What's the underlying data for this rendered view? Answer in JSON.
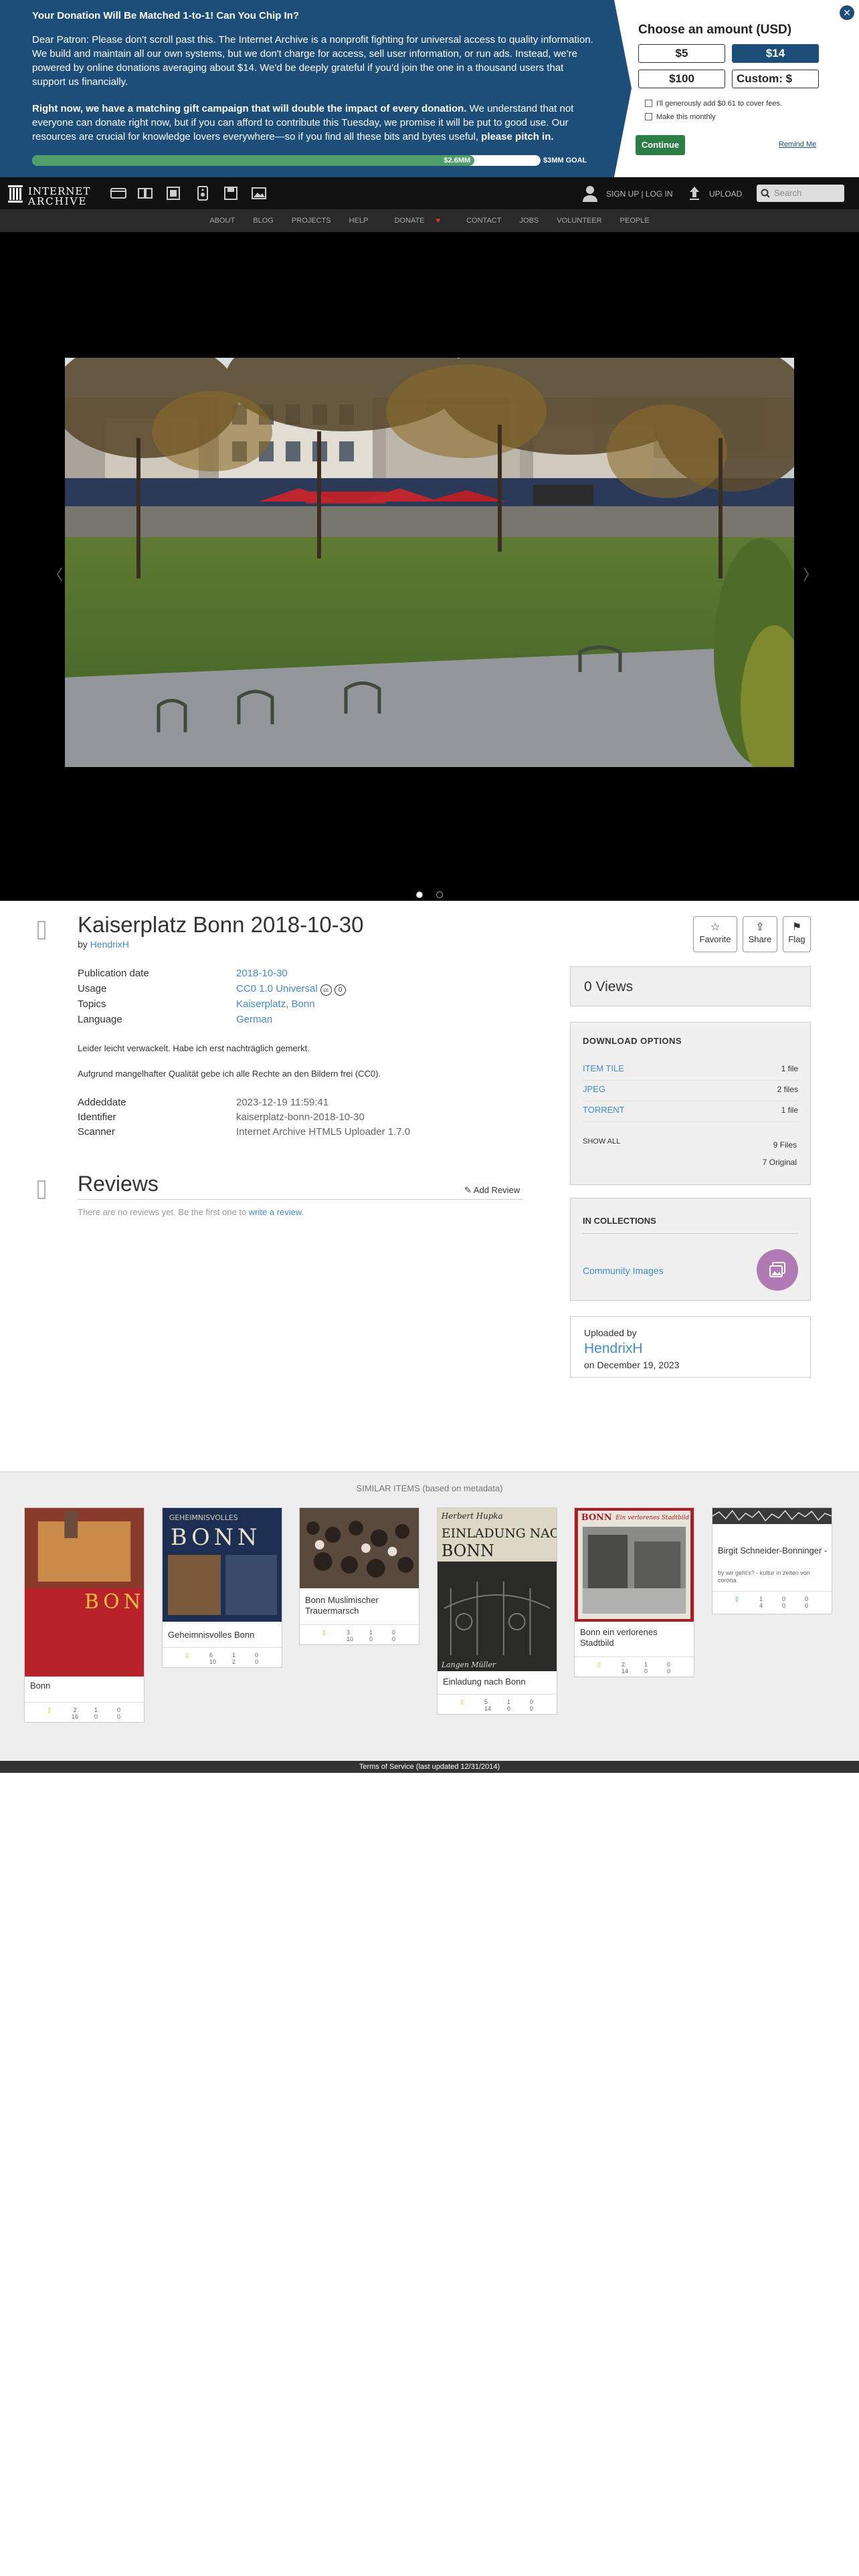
{
  "banner": {
    "headline": "Your Donation Will Be Matched 1-to-1! Can You Chip In?",
    "para1": "Dear Patron: Please don't scroll past this. The Internet Archive is a nonprofit fighting for universal access to quality information. We build and maintain all our own systems, but we don't charge for access, sell user information, or run ads. Instead, we're powered by online donations averaging about $14. We'd be deeply grateful if you'd join the one in a thousand users that support us financially.",
    "para2_bold": "Right now, we have a matching gift campaign that will double the impact of every donation.",
    "para2_rest": " We understand that not everyone can donate right now, but if you can afford to contribute this Tuesday, we promise it will be put to good use. Our resources are crucial for knowledge lovers everywhere—so if you find all these bits and bytes useful, ",
    "para2_end": "please pitch in.",
    "raised": "$2.6MM",
    "goal": "$3MM GOAL",
    "progress_fraction": 0.87,
    "choose_label": "Choose an amount (USD)",
    "amounts": [
      "$5",
      "$14",
      "$100",
      "Custom: $"
    ],
    "fee_label": "I'll generously add $0.61 to cover fees.",
    "monthly_label": "Make this monthly",
    "continue_label": "Continue",
    "remind_label": "Remind Me",
    "close_glyph": "✕",
    "colors": {
      "banner_bg": "#1d4e7a",
      "selected_amount": "#1d4e7a",
      "continue": "#2d7d46"
    }
  },
  "nav": {
    "logo_line1": "INTERNET",
    "logo_line2": "ARCHIVE",
    "media_icons": [
      "web-icon",
      "texts-icon",
      "video-icon",
      "audio-icon",
      "software-icon",
      "images-icon"
    ],
    "signin": "SIGN UP | LOG IN",
    "upload": "UPLOAD",
    "search_placeholder": "Search",
    "links": [
      "ABOUT",
      "BLOG",
      "PROJECTS",
      "HELP",
      "DONATE",
      "CONTACT",
      "JOBS",
      "VOLUNTEER",
      "PEOPLE"
    ]
  },
  "viewer": {
    "prev": "〈",
    "next": "〉"
  },
  "item": {
    "title": "Kaiserplatz Bonn 2018-10-30",
    "by_label": "by",
    "author": "HendrixH",
    "actions": {
      "favorite": "Favorite",
      "share": "Share",
      "flag": "Flag"
    },
    "meta": {
      "pubdate_label": "Publication date",
      "pubdate": "2018-10-30",
      "usage_label": "Usage",
      "usage": "CC0 1.0 Universal",
      "topics_label": "Topics",
      "topic1": "Kaiserplatz",
      "topic_sep": ", ",
      "topic2": "Bonn",
      "language_label": "Language",
      "language": "German"
    },
    "desc1": "Leider leicht verwackelt. Habe ich erst nachträglich gemerkt.",
    "desc2": "Aufgrund mangelhafter Qualität gebe ich alle Rechte an den Bildern frei (CC0).",
    "meta2": {
      "added_label": "Addeddate",
      "added": "2023-12-19 11:59:41",
      "identifier_label": "Identifier",
      "identifier": "kaiserplatz-bonn-2018-10-30",
      "scanner_label": "Scanner",
      "scanner": "Internet Archive HTML5 Uploader 1.7.0"
    }
  },
  "reviews": {
    "heading": "Reviews",
    "add": "Add Review",
    "none_text": "There are no reviews yet. Be the first one to ",
    "none_link": "write a review",
    "none_end": "."
  },
  "sidebar": {
    "views": "0 Views",
    "download_heading": "DOWNLOAD OPTIONS",
    "downloads": [
      {
        "label": "ITEM TILE",
        "count": "1 file"
      },
      {
        "label": "JPEG",
        "count": "2 files"
      },
      {
        "label": "TORRENT",
        "count": "1 file"
      }
    ],
    "show_all": "SHOW ALL",
    "files": "9 Files",
    "original": "7 Original",
    "collections_heading": "IN COLLECTIONS",
    "collection": "Community Images",
    "uploaded_by_label": "Uploaded by",
    "uploader": "HendrixH",
    "uploaded_on": "on December 19, 2023"
  },
  "similar": {
    "heading": "SIMILAR ITEMS (based on metadata)",
    "cards": [
      {
        "title": "Bonn",
        "views": "2\n16",
        "favs": "1\n0",
        "reviews": "0\n0"
      },
      {
        "title": "Geheimnisvolles Bonn",
        "views": "6\n10",
        "favs": "1\n2",
        "reviews": "0\n0"
      },
      {
        "title": "Bonn Muslimischer Trauermarsch",
        "views": "3\n10",
        "favs": "1\n0",
        "reviews": "0\n0"
      },
      {
        "title": "Einladung nach Bonn",
        "views": "5\n14",
        "favs": "1\n0",
        "reviews": "0\n0"
      },
      {
        "title": "Bonn ein verlorenes Stadtbild",
        "views": "2\n14",
        "favs": "1\n0",
        "reviews": "0\n0"
      },
      {
        "title": "Birgit Schneider-Bonninger -",
        "subtitle": "by wir geht's? - kultur in zeiten von corona",
        "views": "1\n4",
        "favs": "0\n0",
        "reviews": "0\n0"
      }
    ],
    "cover_texts": {
      "c1": "BONN",
      "c2a": "GEHEIMNISVOLLES",
      "c2b": "BONN",
      "c4a": "Herbert Hupka",
      "c4b": "EINLADUNG NACH",
      "c4c": "BONN",
      "c4d": "Langen Müller",
      "c5a": "BONN",
      "c5b": "Ein verlorenes Stadtbild"
    }
  },
  "footer": "Terms of Service (last updated 12/31/2014)"
}
